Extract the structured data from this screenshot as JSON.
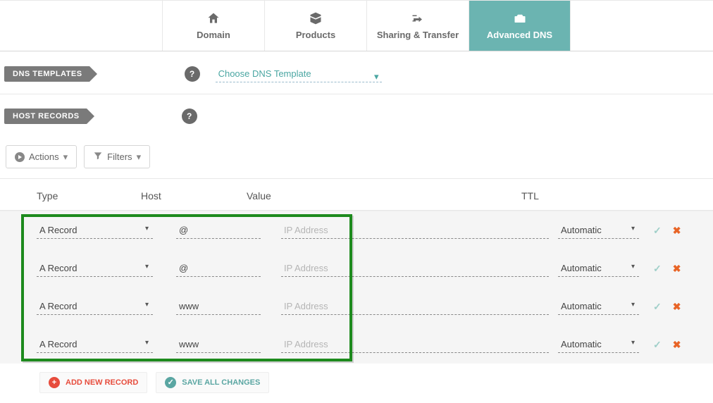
{
  "tabs": [
    {
      "label": "Domain"
    },
    {
      "label": "Products"
    },
    {
      "label": "Sharing & Transfer"
    },
    {
      "label": "Advanced DNS"
    }
  ],
  "sections": {
    "dns_templates": "DNS TEMPLATES",
    "host_records": "HOST RECORDS"
  },
  "template_select": "Choose DNS Template",
  "toolbar": {
    "actions": "Actions",
    "filters": "Filters"
  },
  "headers": {
    "type": "Type",
    "host": "Host",
    "value": "Value",
    "ttl": "TTL"
  },
  "records": [
    {
      "type": "A Record",
      "host": "@",
      "value": "",
      "placeholder": "IP Address",
      "ttl": "Automatic"
    },
    {
      "type": "A Record",
      "host": "@",
      "value": "",
      "placeholder": "IP Address",
      "ttl": "Automatic"
    },
    {
      "type": "A Record",
      "host": "www",
      "value": "",
      "placeholder": "IP Address",
      "ttl": "Automatic"
    },
    {
      "type": "A Record",
      "host": "www",
      "value": "",
      "placeholder": "IP Address",
      "ttl": "Automatic"
    }
  ],
  "footer": {
    "add": "ADD NEW RECORD",
    "save": "SAVE ALL CHANGES"
  }
}
